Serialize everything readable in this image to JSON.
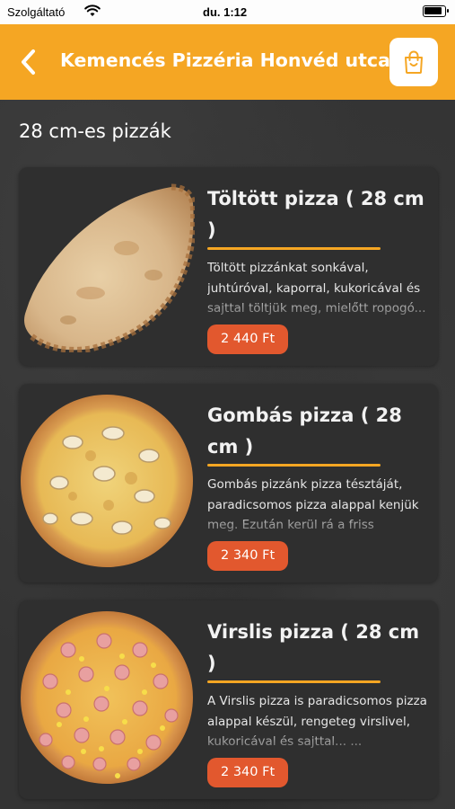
{
  "status_bar": {
    "carrier": "Szolgáltató",
    "time": "du. 1:12"
  },
  "nav": {
    "title": "Kemencés Pizzéria Honvéd utca",
    "back_icon": "chevron-left-icon",
    "cart_icon": "shopping-bag-icon"
  },
  "colors": {
    "accent": "#f5a623",
    "price_badge": "#e2582e",
    "card_bg": "#2f2f2f"
  },
  "section": {
    "title": "28 cm-es pizzák"
  },
  "products": [
    {
      "name": "Töltött pizza ( 28 cm )",
      "description": "Töltött pizzánkat sonkával, juhtúróval, kaporral, kukoricával és sajttal töltjük meg, mielőtt ropogó...",
      "price": "2 440 Ft"
    },
    {
      "name": "Gombás pizza ( 28 cm )",
      "description": "Gombás pizzánk pizza tésztáját, paradicsomos pizza alappal kenjük meg. Ezután kerül rá a friss gomba...",
      "price": "2 340 Ft"
    },
    {
      "name": "Virslis pizza ( 28 cm )",
      "description": "A Virslis pizza is paradicsomos pizza alappal készül, rengeteg virslivel, kukoricával és sajttal... ...",
      "price": "2 340 Ft"
    }
  ]
}
